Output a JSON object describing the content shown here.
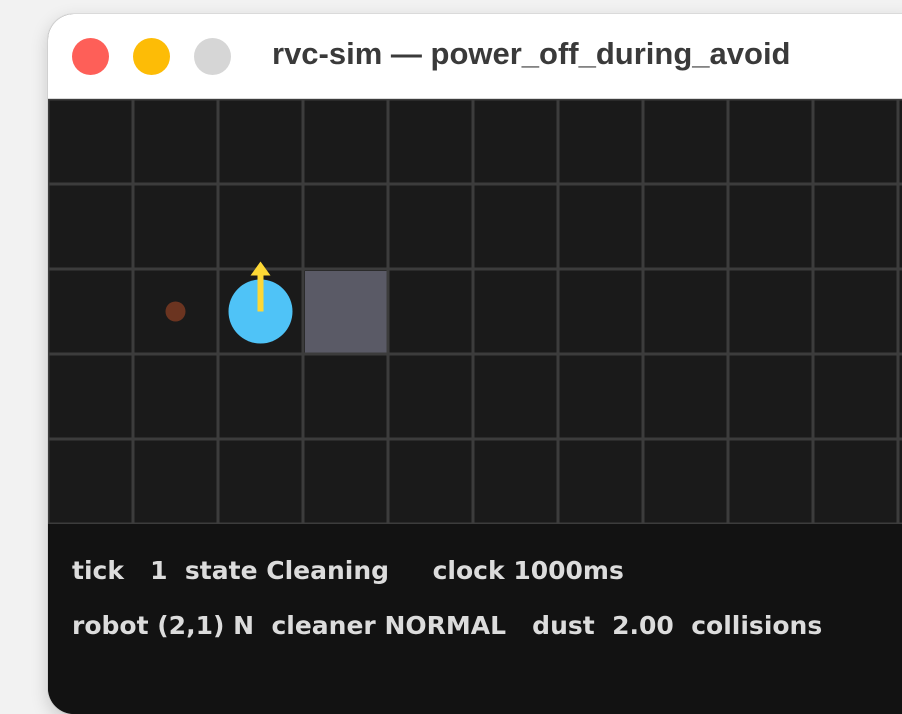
{
  "window": {
    "title": "rvc-sim — power_off_during_avoid",
    "buttons": {
      "close": "close-button",
      "minimize": "minimize-button",
      "zoom": "zoom-button"
    }
  },
  "grid": {
    "columns": 10,
    "rows": 5,
    "background_color": "#1a1a1a",
    "line_color": "#3c3c3c",
    "obstacles": [
      {
        "col": 3,
        "row": 2,
        "color": "#5a5a66"
      }
    ],
    "dust": [
      {
        "col": 1,
        "row": 2,
        "color": "#6b3420"
      }
    ],
    "robot": {
      "col": 2,
      "row": 2,
      "heading": "N",
      "body_color": "#4fc3f7",
      "arrow_color": "#fdd835"
    }
  },
  "status": {
    "tick_label": "tick",
    "tick_value": "1",
    "state_label": "state",
    "state_value": "Cleaning",
    "clock_label": "clock",
    "clock_value": "1000ms",
    "robot_label": "robot",
    "robot_value": "(2,1) N",
    "cleaner_label": "cleaner",
    "cleaner_value": "NORMAL",
    "dust_label": "dust",
    "dust_value": "2.00",
    "collisions_label": "collisions"
  }
}
